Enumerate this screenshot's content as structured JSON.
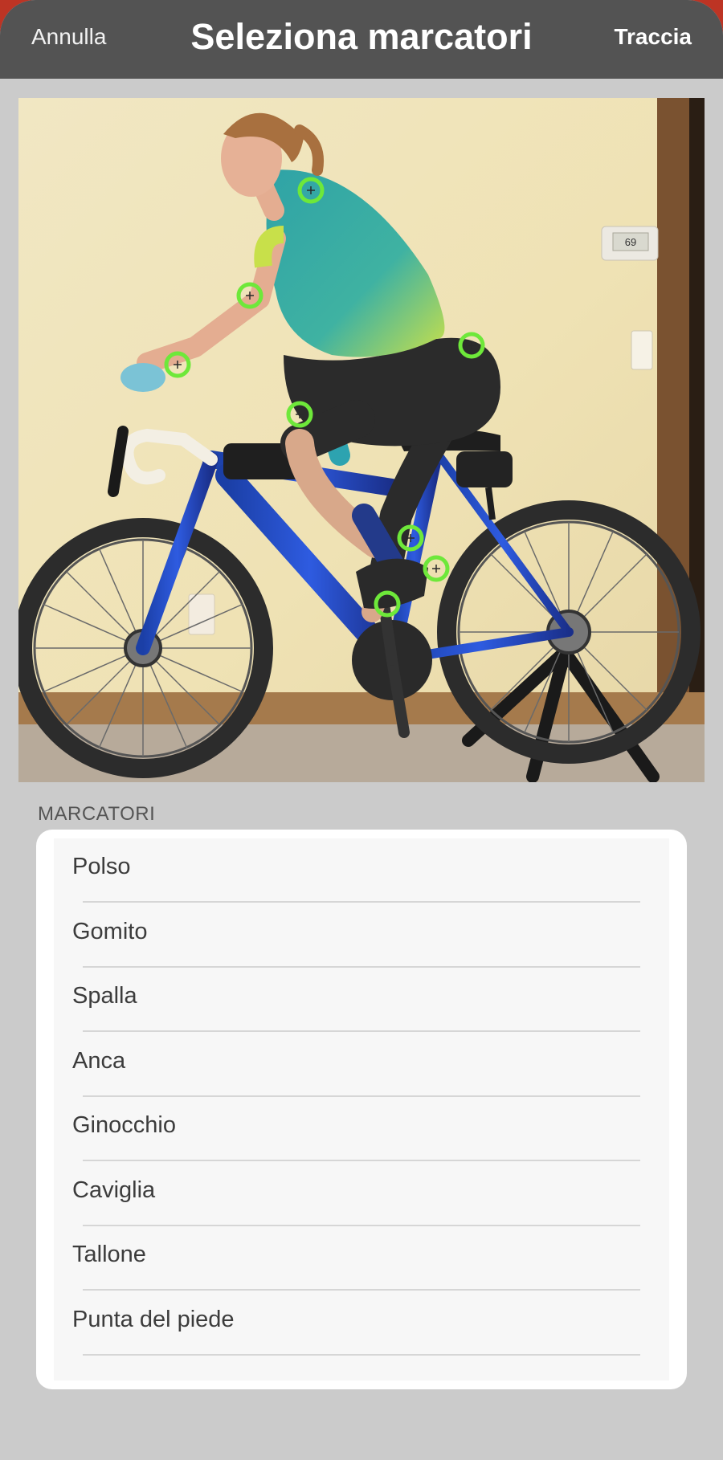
{
  "navbar": {
    "cancel_label": "Annulla",
    "title": "Seleziona marcatori",
    "action_label": "Traccia"
  },
  "photo": {
    "thermostat_reading": "69",
    "marker_color": "#6ee83a"
  },
  "markers_section": {
    "header": "MARCATORI",
    "items": [
      {
        "label": "Polso"
      },
      {
        "label": "Gomito"
      },
      {
        "label": "Spalla"
      },
      {
        "label": "Anca"
      },
      {
        "label": "Ginocchio"
      },
      {
        "label": "Caviglia"
      },
      {
        "label": "Tallone"
      },
      {
        "label": "Punta del piede"
      }
    ]
  },
  "colors": {
    "navbar_background": "#535353",
    "sheet_background": "#cbcbcb",
    "accent_red": "#bd3424"
  }
}
